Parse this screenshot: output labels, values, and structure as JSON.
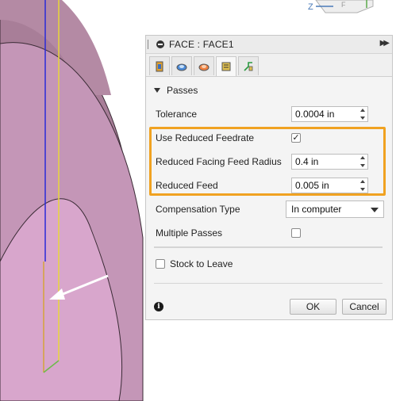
{
  "viewport": {
    "face_colors": {
      "back": "#a87e98",
      "mid": "#c496b7",
      "front": "#d8a6cc",
      "edge": "#3a2b35"
    },
    "viewcube_axis": "Z",
    "viewcube_face": "F"
  },
  "panel": {
    "title": "FACE : FACE1",
    "expand_icon": "double-chevron-right",
    "tabs": [
      {
        "name": "tool-tab",
        "icon": "tool-icon"
      },
      {
        "name": "geometry-tab",
        "icon": "geometry-icon"
      },
      {
        "name": "heights-tab",
        "icon": "heights-icon"
      },
      {
        "name": "passes-tab",
        "icon": "passes-icon",
        "active": true
      },
      {
        "name": "linking-tab",
        "icon": "linking-icon"
      }
    ],
    "section_title": "Passes",
    "tolerance": {
      "label": "Tolerance",
      "value": "0.0004 in"
    },
    "use_reduced_feedrate": {
      "label": "Use Reduced Feedrate",
      "checked": true
    },
    "reduced_facing_feed_radius": {
      "label": "Reduced Facing Feed Radius",
      "value": "0.4 in"
    },
    "reduced_feed": {
      "label": "Reduced Feed",
      "value": "0.005 in"
    },
    "compensation_type": {
      "label": "Compensation Type",
      "value": "In computer"
    },
    "multiple_passes": {
      "label": "Multiple Passes",
      "checked": false
    },
    "stock_to_leave": {
      "label": "Stock to Leave",
      "checked": false
    },
    "ok_label": "OK",
    "cancel_label": "Cancel",
    "highlight_color": "#f0a221"
  }
}
